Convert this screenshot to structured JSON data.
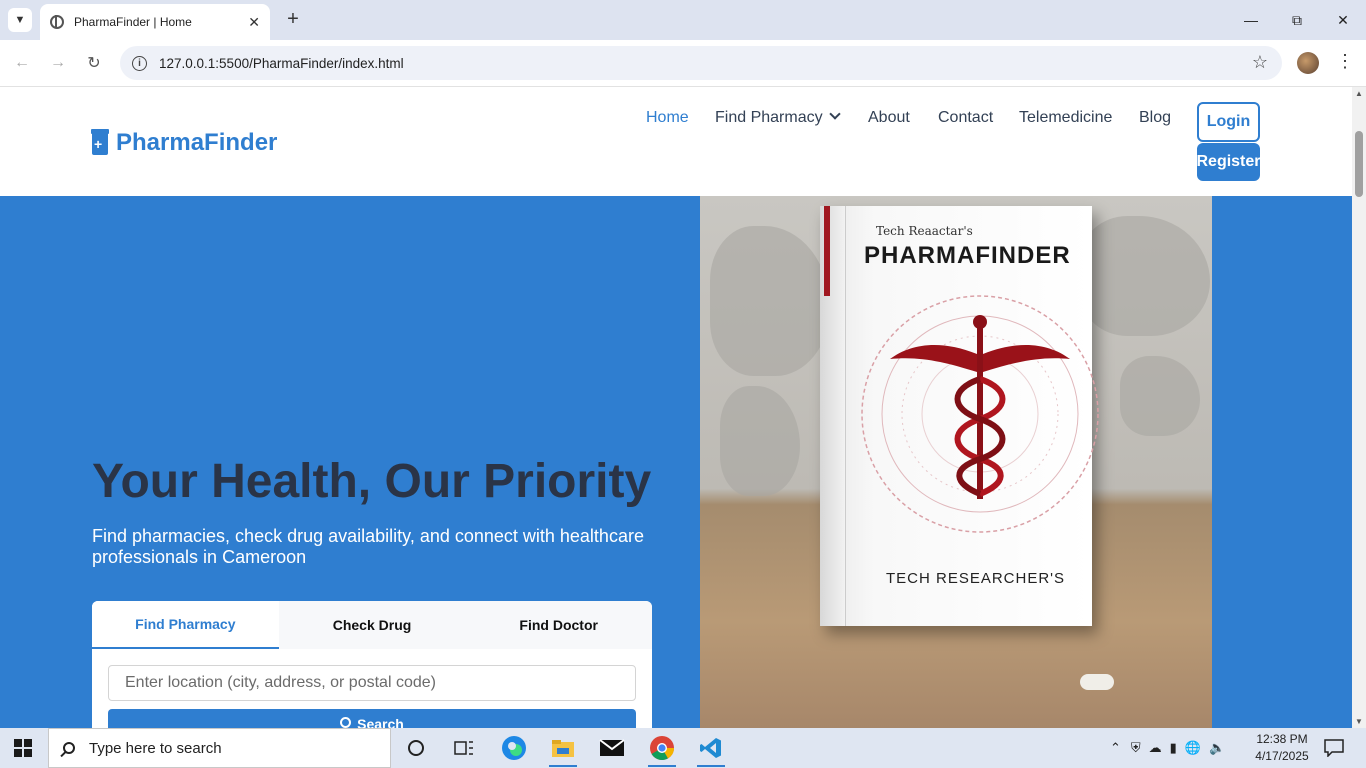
{
  "browser": {
    "tab_title": "PharmaFinder | Home",
    "url": "127.0.0.1:5500/PharmaFinder/index.html"
  },
  "site": {
    "logo_text": "PharmaFinder",
    "nav": {
      "home": "Home",
      "find_pharmacy": "Find Pharmacy",
      "about": "About",
      "contact": "Contact",
      "telemedicine": "Telemedicine",
      "blog": "Blog"
    },
    "login": "Login",
    "register": "Register"
  },
  "hero": {
    "title": "Your Health, Our Priority",
    "subtitle": "Find pharmacies, check drug availability, and connect with healthcare professionals in Cameroon",
    "tabs": [
      "Find Pharmacy",
      "Check Drug",
      "Find Doctor"
    ],
    "active_tab": "Find Pharmacy",
    "search_placeholder": "Enter location (city, address, or postal code)",
    "search_button": "Search",
    "image": {
      "book_top_text": "Tech Reaactar's",
      "book_title": "PHARMAFINDER",
      "book_bottom_text": "TECH RESEARCHER'S"
    }
  },
  "taskbar": {
    "search_placeholder": "Type here to search",
    "time": "12:38 PM",
    "date": "4/17/2025"
  },
  "colors": {
    "brand": "#2f7ed0",
    "hero_title": "#2a3447"
  }
}
